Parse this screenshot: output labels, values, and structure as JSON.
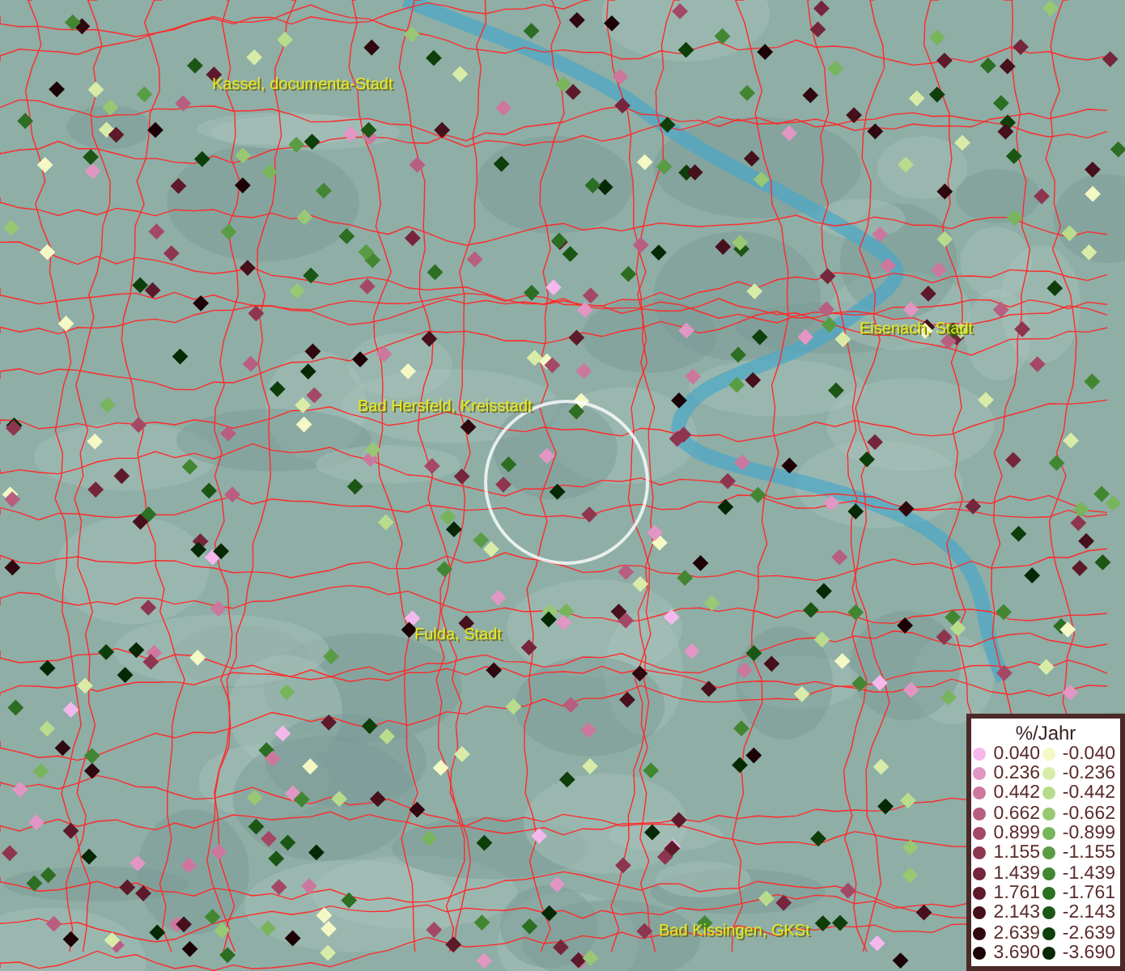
{
  "map": {
    "places": [
      {
        "name": "Kassel, documenta-Stadt"
      },
      {
        "name": "Eisenach, Stadt"
      },
      {
        "name": "Bad Hersfeld, Kreisstadt"
      },
      {
        "name": "Fulda, Stadt"
      },
      {
        "name": "Bad Kissingen, GKSt"
      }
    ]
  },
  "legend": {
    "title": "%/Jahr",
    "positive": [
      {
        "label": "0.040",
        "color": "#f4b8ec"
      },
      {
        "label": "0.236",
        "color": "#e296c4"
      },
      {
        "label": "0.442",
        "color": "#cc789e"
      },
      {
        "label": "0.662",
        "color": "#b85e80"
      },
      {
        "label": "0.899",
        "color": "#a44866"
      },
      {
        "label": "1.155",
        "color": "#8e3650"
      },
      {
        "label": "1.439",
        "color": "#76263c"
      },
      {
        "label": "1.761",
        "color": "#5e1a2a"
      },
      {
        "label": "2.143",
        "color": "#46101c"
      },
      {
        "label": "2.639",
        "color": "#300810"
      },
      {
        "label": "3.690",
        "color": "#1c0206"
      }
    ],
    "negative": [
      {
        "label": "-0.040",
        "color": "#f4f8c4"
      },
      {
        "label": "-0.236",
        "color": "#d8eca8"
      },
      {
        "label": "-0.442",
        "color": "#b8dc8c"
      },
      {
        "label": "-0.662",
        "color": "#98c874"
      },
      {
        "label": "-0.899",
        "color": "#78b45c"
      },
      {
        "label": "-1.155",
        "color": "#5a9c44"
      },
      {
        "label": "-1.439",
        "color": "#428632"
      },
      {
        "label": "-1.761",
        "color": "#2c6e22"
      },
      {
        "label": "-2.143",
        "color": "#1c5614"
      },
      {
        "label": "-2.639",
        "color": "#0e3e0a"
      },
      {
        "label": "-3.690",
        "color": "#062804"
      }
    ]
  }
}
